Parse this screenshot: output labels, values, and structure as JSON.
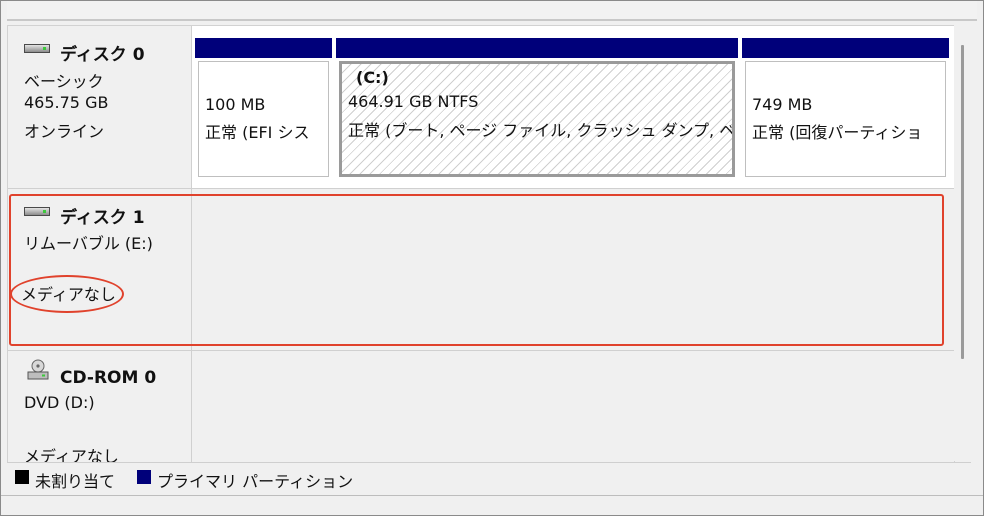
{
  "colors": {
    "primary_partition": "#00007a",
    "unallocated": "#000000",
    "highlight": "#e0422c"
  },
  "disks": [
    {
      "title": "ディスク 0",
      "type": "ベーシック",
      "size": "465.75 GB",
      "status": "オンライン",
      "partitions": [
        {
          "name": "",
          "size": "100 MB",
          "status": "正常 (EFI シス"
        },
        {
          "name": "(C:)",
          "size": "464.91 GB NTFS",
          "status": "正常 (ブート, ページ ファイル, クラッシュ ダンプ, ベ"
        },
        {
          "name": "",
          "size": "749 MB",
          "status": "正常 (回復パーティショ"
        }
      ]
    },
    {
      "title": "ディスク 1",
      "type": "リムーバブル (E:)",
      "status": "メディアなし"
    },
    {
      "title": "CD-ROM 0",
      "type": "DVD (D:)",
      "status": "メディアなし"
    }
  ],
  "legend": [
    {
      "label": "未割り当て",
      "color": "#000000"
    },
    {
      "label": "プライマリ パーティション",
      "color": "#00007a"
    }
  ]
}
